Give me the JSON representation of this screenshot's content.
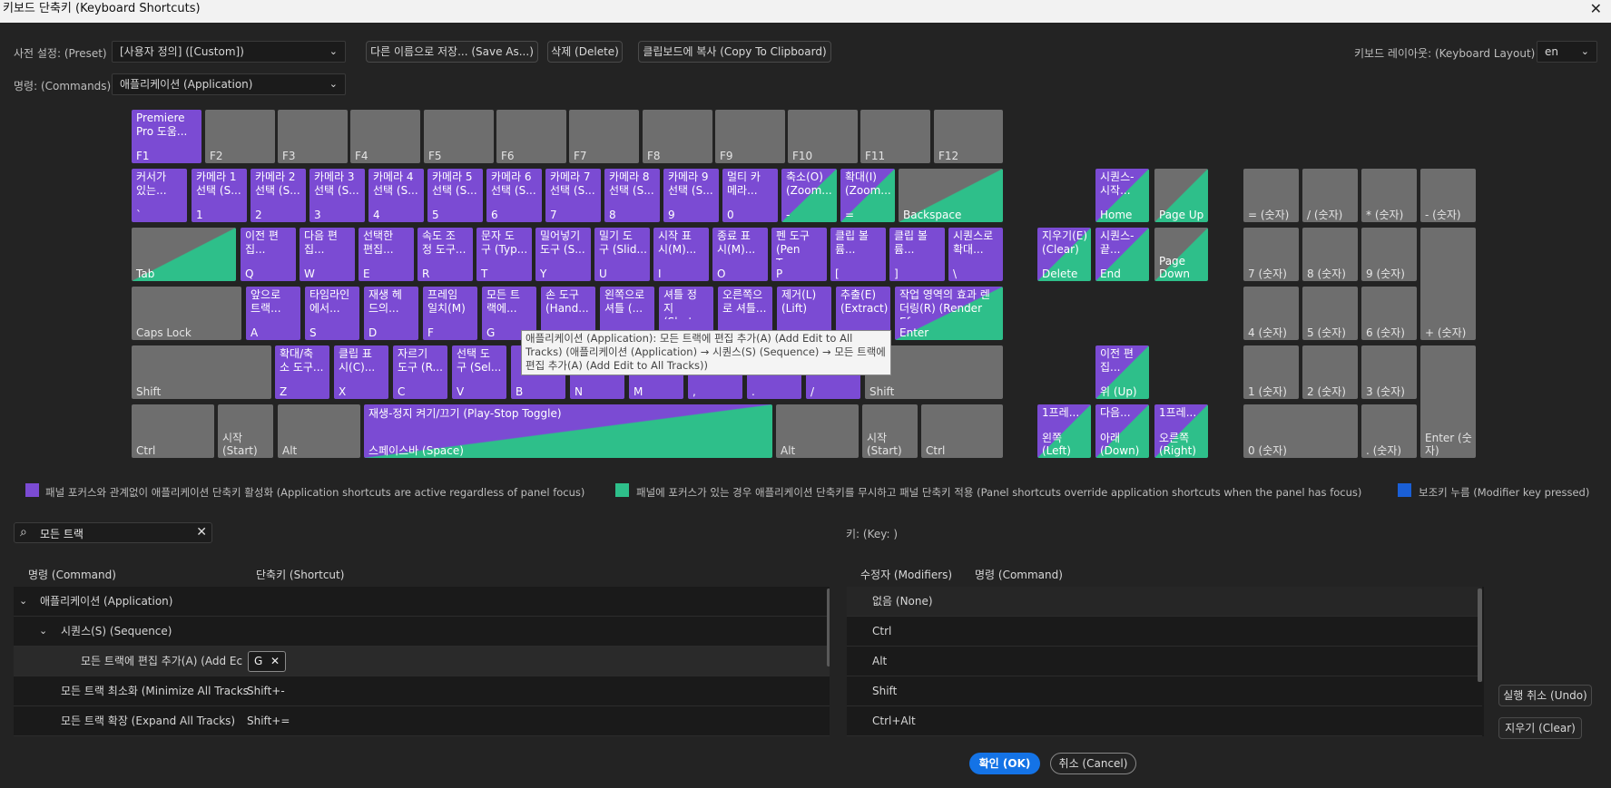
{
  "window": {
    "title": "키보드 단축키 (Keyboard Shortcuts)"
  },
  "toolbar": {
    "preset_label": "사전 설정: (Preset)",
    "preset_value": "[사용자 정의] ([Custom])",
    "save_as": "다른 이름으로 저장... (Save As...)",
    "delete": "삭제 (Delete)",
    "copy": "클립보드에 복사 (Copy To Clipboard)",
    "layout_label": "키보드 레이아웃: (Keyboard Layout)",
    "layout_value": "en",
    "commands_label": "명령: (Commands)",
    "commands_value": "애플리케이션 (Application)"
  },
  "keyboard": {
    "f1": {
      "cmd": "Premiere\nPro 도움...",
      "key": "F1"
    },
    "f2": "F2",
    "f3": "F3",
    "f4": "F4",
    "f5": "F5",
    "f6": "F6",
    "f7": "F7",
    "f8": "F8",
    "f9": "F9",
    "f10": "F10",
    "f11": "F11",
    "f12": "F12",
    "grave": {
      "cmd": "커서가\n있는...",
      "key": "`"
    },
    "k1": {
      "cmd": "카메라 1\n선택 (S...",
      "key": "1"
    },
    "k2": {
      "cmd": "카메라 2\n선택 (S...",
      "key": "2"
    },
    "k3": {
      "cmd": "카메라 3\n선택 (S...",
      "key": "3"
    },
    "k4": {
      "cmd": "카메라 4\n선택 (S...",
      "key": "4"
    },
    "k5": {
      "cmd": "카메라 5\n선택 (S...",
      "key": "5"
    },
    "k6": {
      "cmd": "카메라 6\n선택 (S...",
      "key": "6"
    },
    "k7": {
      "cmd": "카메라 7\n선택 (S...",
      "key": "7"
    },
    "k8": {
      "cmd": "카메라 8\n선택 (S...",
      "key": "8"
    },
    "k9": {
      "cmd": "카메라 9\n선택 (S...",
      "key": "9"
    },
    "k0": {
      "cmd": "멀티 카\n메라...",
      "key": "0"
    },
    "minus": {
      "cmd": "축소(O)\n(Zoom...",
      "key": "-"
    },
    "equal": {
      "cmd": "확대(I)\n(Zoom...",
      "key": "="
    },
    "backspace": "Backspace",
    "tab": "Tab",
    "q": {
      "cmd": "이전 편\n집...",
      "key": "Q"
    },
    "w": {
      "cmd": "다음 편\n집...",
      "key": "W"
    },
    "e": {
      "cmd": "선택한\n편집...",
      "key": "E"
    },
    "r": {
      "cmd": "속도 조\n정 도구...",
      "key": "R"
    },
    "t": {
      "cmd": "문자 도\n구 (Typ...",
      "key": "T"
    },
    "y": {
      "cmd": "밀어넣기\n도구 (S...",
      "key": "Y"
    },
    "u": {
      "cmd": "밀기 도\n구 (Slid...",
      "key": "U"
    },
    "i": {
      "cmd": "시작 표\n시(M)...",
      "key": "I"
    },
    "o": {
      "cmd": "종료 표\n시(M)...",
      "key": "O"
    },
    "p": {
      "cmd": "펜 도구\n(Pen To...",
      "key": "P"
    },
    "lbr": {
      "cmd": "클립 볼\n륨...",
      "key": "["
    },
    "rbr": {
      "cmd": "클립 볼\n륨...",
      "key": "]"
    },
    "bslash": {
      "cmd": "시퀀스로\n확대...",
      "key": "\\"
    },
    "caps": "Caps Lock",
    "a": {
      "cmd": "앞으로\n트랙...",
      "key": "A"
    },
    "s": {
      "cmd": "타임라인\n에서...",
      "key": "S"
    },
    "d": {
      "cmd": "재생 헤\n드의...",
      "key": "D"
    },
    "f": {
      "cmd": "프레임\n일치(M)\n...",
      "key": "F"
    },
    "g": {
      "cmd": "모든 트\n랙에...",
      "key": "G"
    },
    "h": {
      "cmd": "손 도구\n(Hand...",
      "key": ""
    },
    "j": {
      "cmd": "왼쪽으로\n셔틀 (...",
      "key": ""
    },
    "k": {
      "cmd": "셔틀 정\n지\n(Shut...",
      "key": ""
    },
    "l": {
      "cmd": "오른쪽으\n로 셔틀...",
      "key": ""
    },
    "semi": {
      "cmd": "제거(L)\n(Lift)",
      "key": ""
    },
    "quote": {
      "cmd": "추출(E)\n(Extract)",
      "key": ""
    },
    "enter": {
      "cmd": "작업 영역의 효과 렌\n더링(R) (Render Ef...",
      "key": "Enter"
    },
    "lshift": "Shift",
    "z": {
      "cmd": "확대/축\n소 도구...",
      "key": "Z"
    },
    "x": {
      "cmd": "클립 표\n시(C)...",
      "key": "X"
    },
    "c": {
      "cmd": "자르기\n도구 (R...",
      "key": "C"
    },
    "v": {
      "cmd": "선택 도\n구 (Sel...",
      "key": "V"
    },
    "b": {
      "cmd": "",
      "key": "B"
    },
    "n": "N",
    "m": "M",
    "comma": ",",
    "period": ".",
    "slash": "/",
    "rshift": "Shift",
    "lctrl": "Ctrl",
    "lstart": "시작\n(Start)",
    "lalt": "Alt",
    "space": {
      "cmd": "재생-정지 켜기/끄기 (Play-Stop Toggle)",
      "key": "스페이스바 (Space)"
    },
    "ralt": "Alt",
    "rstart": "시작\n(Start)",
    "rctrl": "Ctrl",
    "home": {
      "cmd": "시퀀스-\n시작...",
      "key": "Home"
    },
    "pgup": "Page Up",
    "delete": {
      "cmd": "지우기(E)\n(Clear)",
      "key": "Delete"
    },
    "end": {
      "cmd": "시퀀스-\n끝...",
      "key": "End"
    },
    "pgdn": "Page\nDown",
    "up": {
      "cmd": "이전 편\n집...",
      "key": "위 (Up)"
    },
    "left": {
      "cmd": "1프레...",
      "key": "왼쪽\n(Left)"
    },
    "down": {
      "cmd": "다음...",
      "key": "아래\n(Down)"
    },
    "right": {
      "cmd": "1프레...",
      "key": "오른쪽\n(Right)"
    },
    "np_eq": "= (숫자)",
    "np_div": "/ (숫자)",
    "np_mul": "* (숫자)",
    "np_sub": "- (숫자)",
    "np7": "7 (숫자)",
    "np8": "8 (숫자)",
    "np9": "9 (숫자)",
    "np4": "4 (숫자)",
    "np5": "5 (숫자)",
    "np6": "6 (숫자)",
    "np_add": "+ (숫자)",
    "np1": "1 (숫자)",
    "np2": "2 (숫자)",
    "np3": "3 (숫자)",
    "np0": "0 (숫자)",
    "np_dot": ". (숫자)",
    "np_enter": "Enter (숫\n자)"
  },
  "tooltip": "애플리케이션 (Application): 모든 트랙에 편집 추가(A) (Add Edit to All Tracks) (애플리케이션 (Application) → 시퀀스(S) (Sequence) → 모든 트랙에 편집 추가(A) (Add Edit to All Tracks))",
  "legend": {
    "app": "패널 포커스와 관계없이 애플리케이션 단축키 활성화 (Application shortcuts are active regardless of panel focus)",
    "panel": "패널에 포커스가 있는 경우 애플리케이션 단축키를 무시하고 패널 단축키 적용 (Panel shortcuts override application shortcuts when the panel has focus)",
    "modifier": "보조키 누름 (Modifier key pressed)",
    "colors": {
      "app": "#7b4bd3",
      "panel": "#2ebf8a",
      "modifier": "#1a5fd6"
    }
  },
  "search": {
    "value": "모든 트랙"
  },
  "key_label": "키:  (Key: )",
  "table": {
    "col_command": "명령 (Command)",
    "col_shortcut": "단축키 (Shortcut)",
    "rows": [
      {
        "label": "애플리케이션 (Application)",
        "shortcut": ""
      },
      {
        "label": "시퀀스(S) (Sequence)",
        "shortcut": ""
      },
      {
        "label": "모든 트랙에 편집 추가(A) (Add Ec",
        "shortcut": "G"
      },
      {
        "label": "모든 트랙 최소화 (Minimize All Tracks",
        "shortcut": "Shift+-"
      },
      {
        "label": "모든 트랙 확장 (Expand All Tracks)",
        "shortcut": "Shift+="
      }
    ]
  },
  "modifiers": {
    "col_mod": "수정자 (Modifiers)",
    "col_cmd": "명령 (Command)",
    "rows": [
      "없음 (None)",
      "Ctrl",
      "Alt",
      "Shift",
      "Ctrl+Alt"
    ]
  },
  "side": {
    "undo": "실행 취소 (Undo)",
    "clear": "지우기 (Clear)"
  },
  "footer": {
    "ok": "확인 (OK)",
    "cancel": "취소 (Cancel)"
  }
}
